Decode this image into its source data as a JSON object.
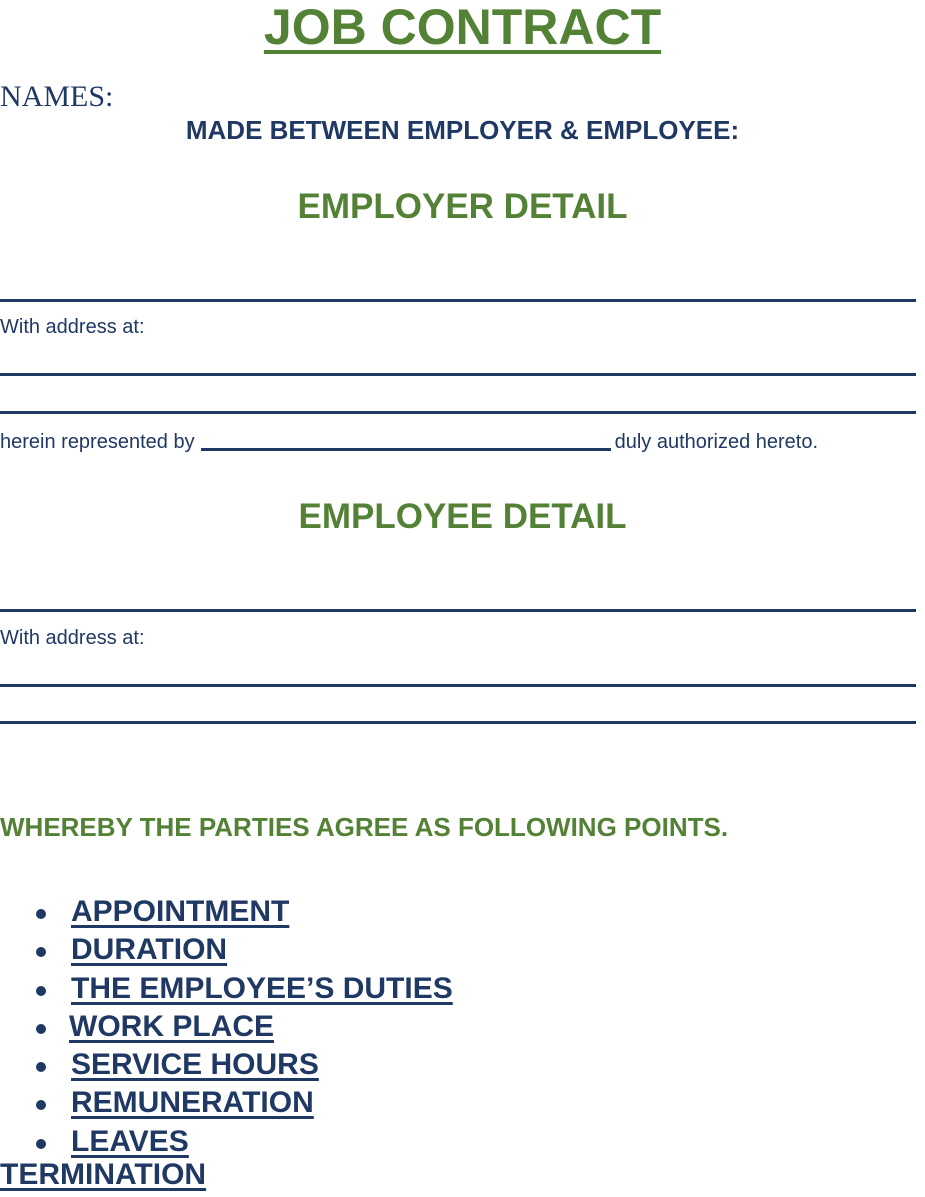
{
  "document": {
    "title": "JOB CONTRACT",
    "names_label": "NAMES:",
    "subtitle": "MADE BETWEEN EMPLOYER & EMPLOYEE:",
    "employer": {
      "heading": "EMPLOYER DETAIL",
      "address_label": "With address at:",
      "represented_prefix": "herein represented by",
      "represented_suffix": "duly authorized hereto."
    },
    "employee": {
      "heading": "EMPLOYEE DETAIL",
      "address_label": "With address at:"
    },
    "agreement_intro": "WHEREBY THE PARTIES AGREE AS FOLLOWING POINTS.",
    "points": [
      "APPOINTMENT",
      "DURATION",
      "THE EMPLOYEE’S DUTIES",
      "WORK PLACE",
      "SERVICE HOURS",
      "REMUNERATION",
      "LEAVES"
    ],
    "final_point": "TERMINATION"
  },
  "colors": {
    "green": "#538135",
    "navy": "#1f3864"
  }
}
